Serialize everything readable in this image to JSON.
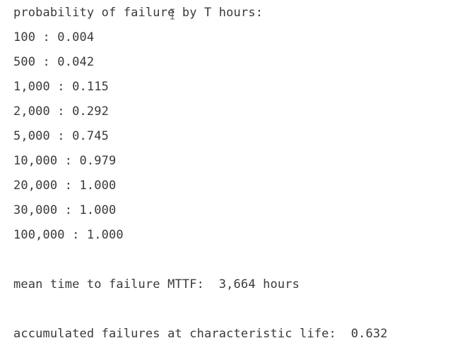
{
  "output": {
    "header": "probability of failure by T hours:",
    "rows": [
      "100 : 0.004",
      "500 : 0.042",
      "1,000 : 0.115",
      "2,000 : 0.292",
      "5,000 : 0.745",
      "10,000 : 0.979",
      "20,000 : 1.000",
      "30,000 : 1.000",
      "100,000 : 1.000"
    ],
    "mttf": "mean time to failure MTTF:  3,664 hours",
    "characteristic": "accumulated failures at characteristic life:  0.632"
  },
  "cursor_icon": "text-cursor-icon"
}
